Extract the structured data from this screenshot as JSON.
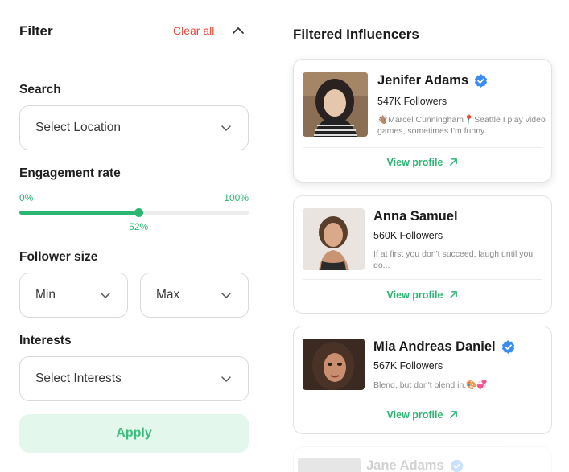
{
  "filter": {
    "title": "Filter",
    "clear_all": "Clear all",
    "search": {
      "label": "Search",
      "placeholder": "Select Location"
    },
    "engagement": {
      "label": "Engagement rate",
      "min_label": "0%",
      "max_label": "100%",
      "value_label": "52%",
      "value": 0.52
    },
    "follower_size": {
      "label": "Follower size",
      "min": "Min",
      "max": "Max"
    },
    "interests": {
      "label": "Interests",
      "placeholder": "Select Interests"
    },
    "apply": "Apply"
  },
  "results": {
    "title": "Filtered Influencers",
    "view_profile": "View profile",
    "cards": [
      {
        "name": "Jenifer Adams",
        "verified": true,
        "followers": "547K  Followers",
        "bio": "👋🏽Marcel Cunningham📍Seattle I play video games, sometimes I'm funny."
      },
      {
        "name": "Anna Samuel",
        "verified": false,
        "followers": "560K  Followers",
        "bio": "If at first you don't succeed, laugh until you do..."
      },
      {
        "name": "Mia Andreas Daniel",
        "verified": true,
        "followers": "567K  Followers",
        "bio": "Blend, but don't blend in.🎨💞"
      },
      {
        "name": "Jane Adams",
        "verified": true
      }
    ]
  },
  "colors": {
    "accent": "#2bb673",
    "danger": "#e5483b",
    "verified": "#3b8cf0",
    "apply_bg": "#e4f7ec"
  },
  "icons": [
    "chevron-up-icon",
    "chevron-down-icon",
    "verified-badge-icon",
    "arrow-up-right-icon"
  ]
}
